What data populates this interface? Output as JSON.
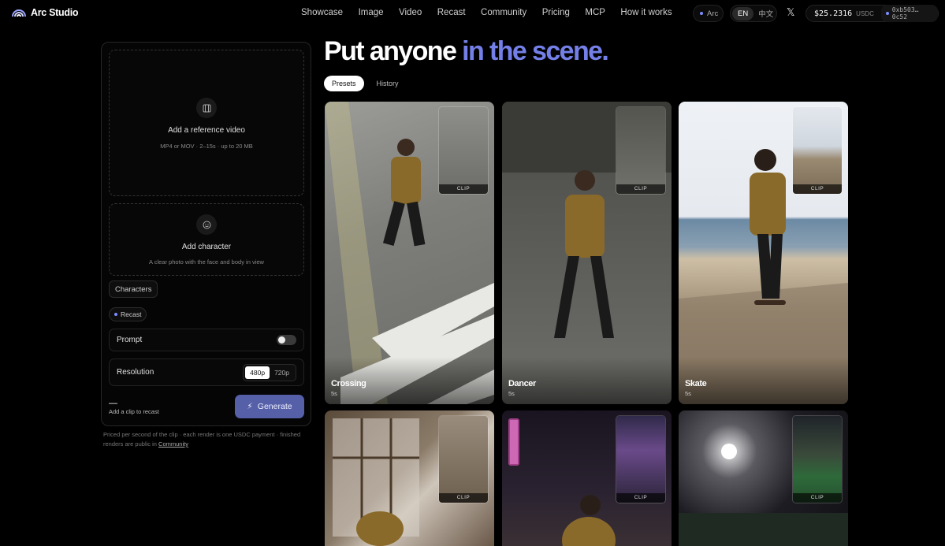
{
  "brand": {
    "name": "Arc Studio",
    "logo_icon": "rainbow-arc-icon"
  },
  "nav": [
    "Showcase",
    "Image",
    "Video",
    "Recast",
    "Community",
    "Pricing",
    "MCP",
    "How it works"
  ],
  "header": {
    "network_label": "Arc",
    "lang_en": "EN",
    "lang_zh": "中文",
    "x_icon": "x-logo-icon",
    "balance": "$25.2316",
    "balance_unit": "USDC",
    "address": "0xb503…0c52"
  },
  "panel": {
    "video_upload": {
      "title": "Add a reference video",
      "sub": "MP4 or MOV · 2–15s · up to 20 MB",
      "icon": "film-icon"
    },
    "char_upload": {
      "title": "Add character",
      "sub": "A clear photo with the face and body in view",
      "icon": "smile-icon"
    },
    "characters_btn": "Characters",
    "mode_chip": "Recast",
    "prompt_label": "Prompt",
    "prompt_toggle_on": false,
    "resolution_label": "Resolution",
    "res_options": [
      "480p",
      "720p"
    ],
    "res_selected": "480p",
    "cost_value": "—",
    "cost_sub": "Add a clip to recast",
    "generate": "Generate",
    "note_text": "Priced per second of the clip · each render is one USDC payment · finished renders are public in ",
    "note_link": "Community"
  },
  "main": {
    "headline_a": "Put anyone ",
    "headline_b": "in the scene.",
    "tabs": [
      "Presets",
      "History"
    ],
    "active_tab": "Presets",
    "clip_label": "CLIP",
    "cards": [
      {
        "title": "Crossing",
        "duration": "5s"
      },
      {
        "title": "Dancer",
        "duration": "5s"
      },
      {
        "title": "Skate",
        "duration": "5s"
      },
      {
        "title": "",
        "duration": ""
      },
      {
        "title": "",
        "duration": ""
      },
      {
        "title": "",
        "duration": ""
      }
    ]
  },
  "colors": {
    "accent": "#7480e8",
    "generate_bg": "#5660a8",
    "bg": "#000000"
  }
}
